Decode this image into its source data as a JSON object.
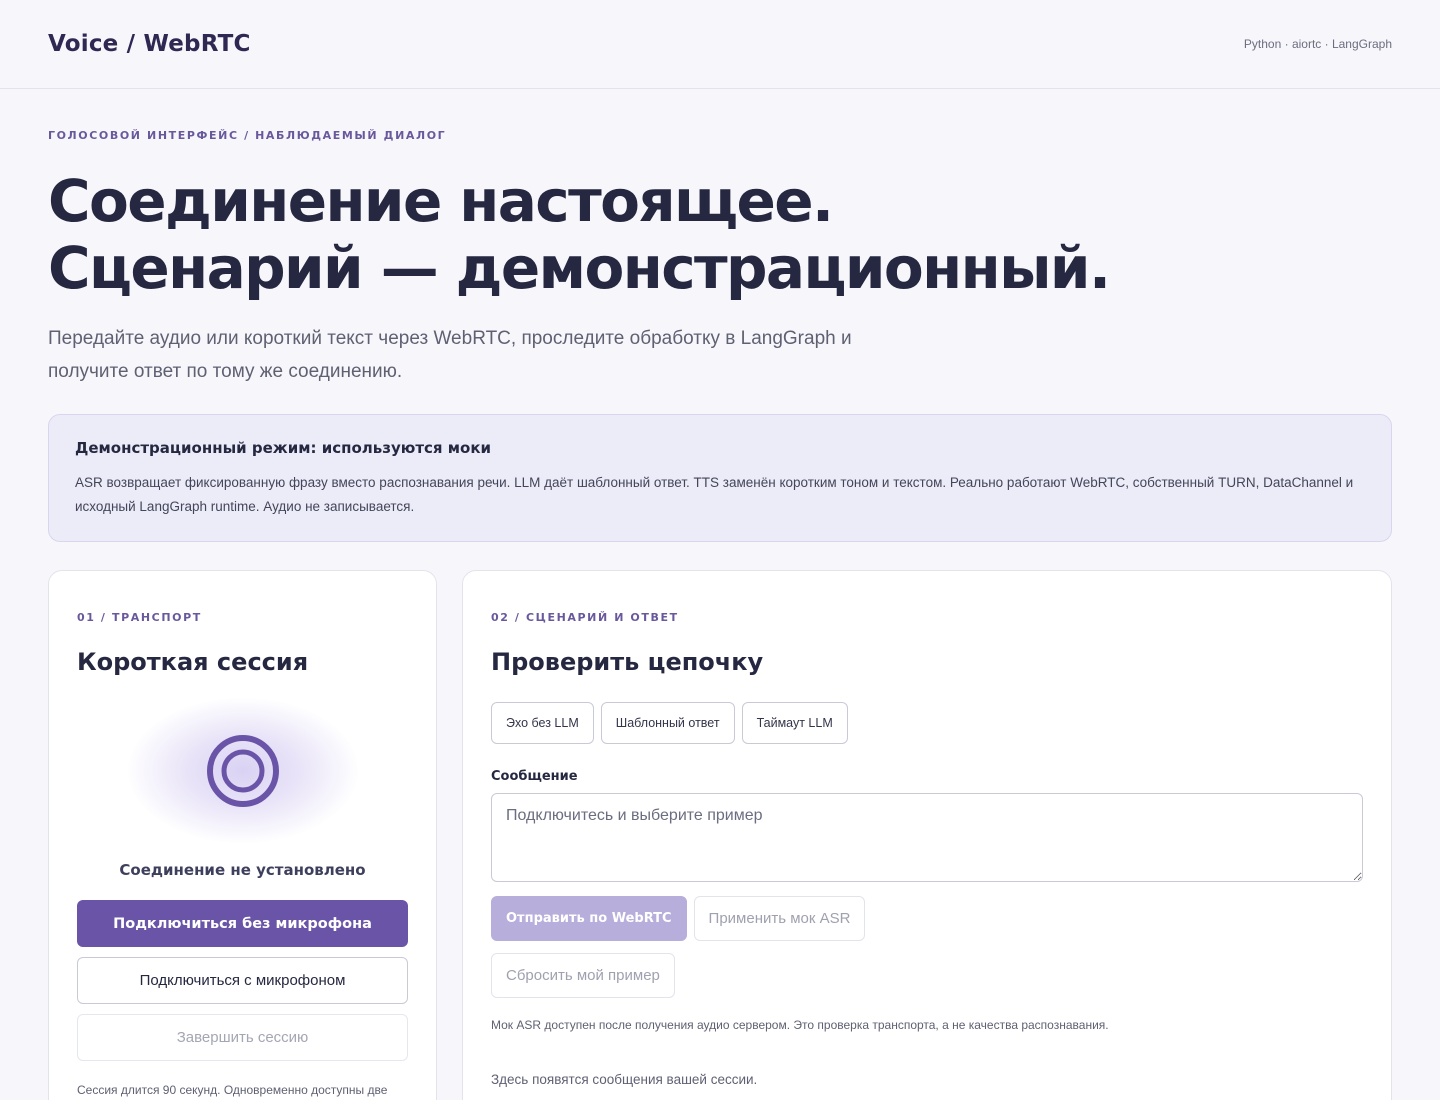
{
  "header": {
    "brand": "Voice / WebRTC",
    "stack": "Python · aiortc · LangGraph"
  },
  "hero": {
    "eyebrow": "ГОЛОСОВОЙ ИНТЕРФЕЙС / НАБЛЮДАЕМЫЙ ДИАЛОГ",
    "title_line1": "Соединение настоящее.",
    "title_line2": "Сценарий — демонстрационный.",
    "lede": "Передайте аудио или короткий текст через WebRTC, проследите обработку в LangGraph и получите ответ по тому же соединению."
  },
  "notice": {
    "title": "Демонстрационный режим: используются моки",
    "text": "ASR возвращает фиксированную фразу вместо распознавания речи. LLM даёт шаблонный ответ. TTS заменён коротким тоном и текстом. Реально работают WebRTC, собственный TURN, DataChannel и исходный LangGraph runtime. Аудио не записывается."
  },
  "transport": {
    "eyebrow": "01 / ТРАНСПОРТ",
    "title": "Короткая сессия",
    "status": "Соединение не установлено",
    "connect_no_mic": "Подключиться без микрофона",
    "connect_mic": "Подключиться с микрофоном",
    "end_session": "Завершить сессию",
    "note": "Сессия длится 90 секунд. Одновременно доступны две",
    "accent": "#6a54a8"
  },
  "scenario": {
    "eyebrow": "02 / СЦЕНАРИЙ И ОТВЕТ",
    "title": "Проверить цепочку",
    "chips": [
      "Эхо без LLM",
      "Шаблонный ответ",
      "Таймаут LLM"
    ],
    "message_label": "Сообщение",
    "message_placeholder": "Подключитесь и выберите пример",
    "send": "Отправить по WebRTC",
    "apply_asr": "Применить мок ASR",
    "reset": "Сбросить мой пример",
    "hint": "Мок ASR доступен после получения аудио сервером. Это проверка транспорта, а не качества распознавания.",
    "empty_log": "Здесь появятся сообщения вашей сессии."
  }
}
